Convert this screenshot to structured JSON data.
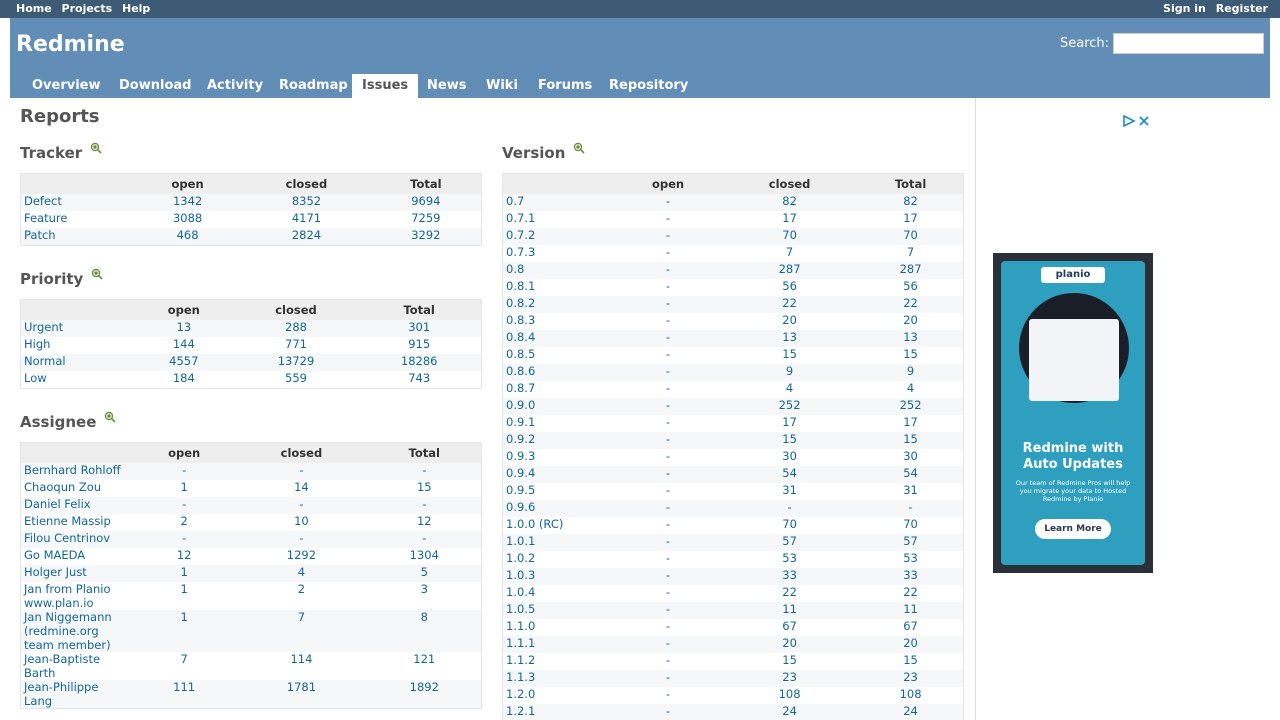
{
  "top_menu": {
    "home": "Home",
    "projects": "Projects",
    "help": "Help",
    "sign_in": "Sign in",
    "register": "Register"
  },
  "header": {
    "title": "Redmine",
    "search_label": "Search:",
    "search_value": ""
  },
  "main_menu": [
    {
      "label": "Overview"
    },
    {
      "label": "Download"
    },
    {
      "label": "Activity"
    },
    {
      "label": "Roadmap"
    },
    {
      "label": "Issues",
      "selected": true
    },
    {
      "label": "News"
    },
    {
      "label": "Wiki"
    },
    {
      "label": "Forums"
    },
    {
      "label": "Repository"
    }
  ],
  "page_title": "Reports",
  "columns": {
    "open": "open",
    "closed": "closed",
    "total": "Total"
  },
  "tracker": {
    "title": "Tracker",
    "rows": [
      {
        "name": "Defect",
        "open": "1342",
        "closed": "8352",
        "total": "9694"
      },
      {
        "name": "Feature",
        "open": "3088",
        "closed": "4171",
        "total": "7259"
      },
      {
        "name": "Patch",
        "open": "468",
        "closed": "2824",
        "total": "3292"
      }
    ]
  },
  "priority": {
    "title": "Priority",
    "rows": [
      {
        "name": "Urgent",
        "open": "13",
        "closed": "288",
        "total": "301"
      },
      {
        "name": "High",
        "open": "144",
        "closed": "771",
        "total": "915"
      },
      {
        "name": "Normal",
        "open": "4557",
        "closed": "13729",
        "total": "18286"
      },
      {
        "name": "Low",
        "open": "184",
        "closed": "559",
        "total": "743"
      }
    ]
  },
  "assignee": {
    "title": "Assignee",
    "rows": [
      {
        "name": "Bernhard Rohloff",
        "open": "-",
        "closed": "-",
        "total": "-"
      },
      {
        "name": "Chaoqun Zou",
        "open": "1",
        "closed": "14",
        "total": "15"
      },
      {
        "name": "Daniel Felix",
        "open": "-",
        "closed": "-",
        "total": "-"
      },
      {
        "name": "Etienne Massip",
        "open": "2",
        "closed": "10",
        "total": "12"
      },
      {
        "name": "Filou Centrinov",
        "open": "-",
        "closed": "-",
        "total": "-"
      },
      {
        "name": "Go MAEDA",
        "open": "12",
        "closed": "1292",
        "total": "1304"
      },
      {
        "name": "Holger Just",
        "open": "1",
        "closed": "4",
        "total": "5"
      },
      {
        "name": "Jan from Planio www.plan.io",
        "open": "1",
        "closed": "2",
        "total": "3"
      },
      {
        "name": "Jan Niggemann (redmine.org team member)",
        "open": "1",
        "closed": "7",
        "total": "8"
      },
      {
        "name": "Jean-Baptiste Barth",
        "open": "7",
        "closed": "114",
        "total": "121"
      },
      {
        "name": "Jean-Philippe Lang",
        "open": "111",
        "closed": "1781",
        "total": "1892"
      }
    ]
  },
  "version": {
    "title": "Version",
    "rows": [
      {
        "name": "0.7",
        "open": "-",
        "closed": "82",
        "total": "82"
      },
      {
        "name": "0.7.1",
        "open": "-",
        "closed": "17",
        "total": "17"
      },
      {
        "name": "0.7.2",
        "open": "-",
        "closed": "70",
        "total": "70"
      },
      {
        "name": "0.7.3",
        "open": "-",
        "closed": "7",
        "total": "7"
      },
      {
        "name": "0.8",
        "open": "-",
        "closed": "287",
        "total": "287"
      },
      {
        "name": "0.8.1",
        "open": "-",
        "closed": "56",
        "total": "56"
      },
      {
        "name": "0.8.2",
        "open": "-",
        "closed": "22",
        "total": "22"
      },
      {
        "name": "0.8.3",
        "open": "-",
        "closed": "20",
        "total": "20"
      },
      {
        "name": "0.8.4",
        "open": "-",
        "closed": "13",
        "total": "13"
      },
      {
        "name": "0.8.5",
        "open": "-",
        "closed": "15",
        "total": "15"
      },
      {
        "name": "0.8.6",
        "open": "-",
        "closed": "9",
        "total": "9"
      },
      {
        "name": "0.8.7",
        "open": "-",
        "closed": "4",
        "total": "4"
      },
      {
        "name": "0.9.0",
        "open": "-",
        "closed": "252",
        "total": "252"
      },
      {
        "name": "0.9.1",
        "open": "-",
        "closed": "17",
        "total": "17"
      },
      {
        "name": "0.9.2",
        "open": "-",
        "closed": "15",
        "total": "15"
      },
      {
        "name": "0.9.3",
        "open": "-",
        "closed": "30",
        "total": "30"
      },
      {
        "name": "0.9.4",
        "open": "-",
        "closed": "54",
        "total": "54"
      },
      {
        "name": "0.9.5",
        "open": "-",
        "closed": "31",
        "total": "31"
      },
      {
        "name": "0.9.6",
        "open": "-",
        "closed": "-",
        "total": "-"
      },
      {
        "name": "1.0.0 (RC)",
        "open": "-",
        "closed": "70",
        "total": "70"
      },
      {
        "name": "1.0.1",
        "open": "-",
        "closed": "57",
        "total": "57"
      },
      {
        "name": "1.0.2",
        "open": "-",
        "closed": "53",
        "total": "53"
      },
      {
        "name": "1.0.3",
        "open": "-",
        "closed": "33",
        "total": "33"
      },
      {
        "name": "1.0.4",
        "open": "-",
        "closed": "22",
        "total": "22"
      },
      {
        "name": "1.0.5",
        "open": "-",
        "closed": "11",
        "total": "11"
      },
      {
        "name": "1.1.0",
        "open": "-",
        "closed": "67",
        "total": "67"
      },
      {
        "name": "1.1.1",
        "open": "-",
        "closed": "20",
        "total": "20"
      },
      {
        "name": "1.1.2",
        "open": "-",
        "closed": "15",
        "total": "15"
      },
      {
        "name": "1.1.3",
        "open": "-",
        "closed": "23",
        "total": "23"
      },
      {
        "name": "1.2.0",
        "open": "-",
        "closed": "108",
        "total": "108"
      },
      {
        "name": "1.2.1",
        "open": "-",
        "closed": "24",
        "total": "24"
      }
    ]
  },
  "ad": {
    "logo": "planio",
    "headline": "Redmine with Auto Updates",
    "subtext": "Our team of Redmine Pros will help you migrate your data to Hosted Redmine by Planio",
    "button": "Learn More"
  },
  "colors": {
    "top_bar": "#3E5B76",
    "header": "#628DB6",
    "link": "#169",
    "ad_bg": "#2f9fbf"
  }
}
